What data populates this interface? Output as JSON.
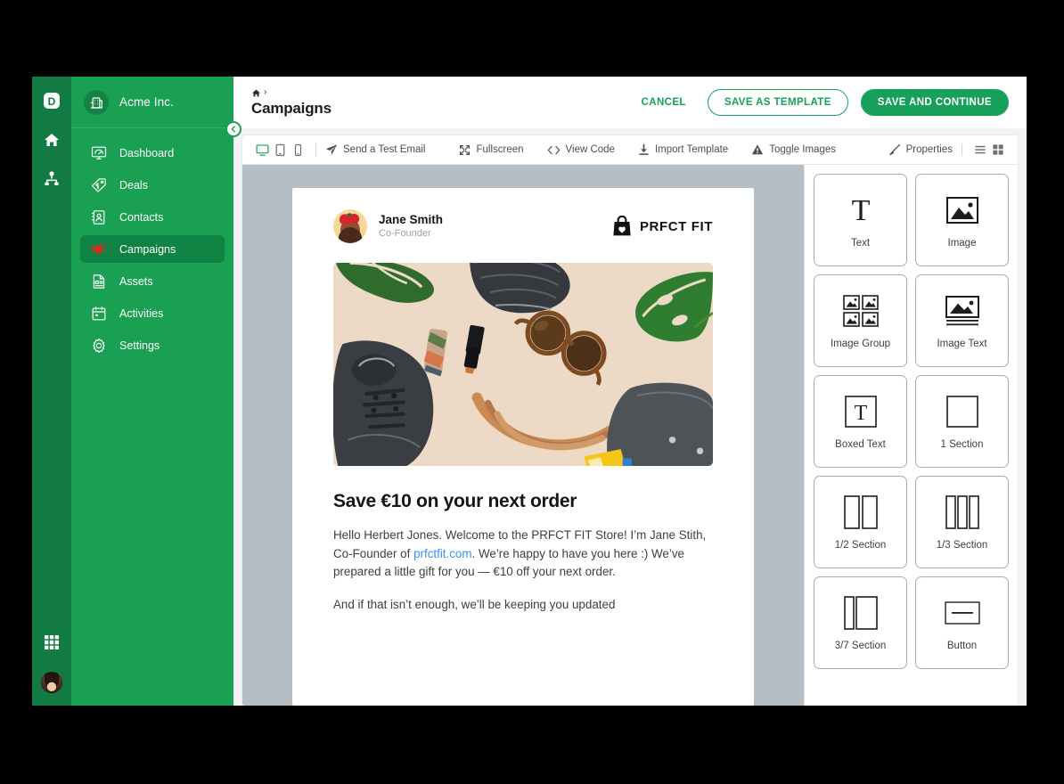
{
  "rail": {
    "items": [
      {
        "name": "app-logo",
        "icon": "d-logo-icon"
      },
      {
        "name": "home",
        "icon": "home-icon"
      },
      {
        "name": "org-tree",
        "icon": "hierarchy-icon"
      }
    ],
    "bottom": [
      {
        "name": "apps-grid",
        "icon": "grid-apps-icon"
      },
      {
        "name": "user-avatar",
        "icon": "avatar-icon"
      }
    ]
  },
  "sidebar": {
    "org_name": "Acme Inc.",
    "org_icon": "building-icon",
    "collapse_icon": "chevron-left-icon",
    "items": [
      {
        "label": "Dashboard",
        "icon": "dashboard-icon",
        "active": false
      },
      {
        "label": "Deals",
        "icon": "tag-icon",
        "active": false
      },
      {
        "label": "Contacts",
        "icon": "contacts-icon",
        "active": false
      },
      {
        "label": "Campaigns",
        "icon": "megaphone-icon",
        "active": true
      },
      {
        "label": "Assets",
        "icon": "assets-icon",
        "active": false
      },
      {
        "label": "Activities",
        "icon": "calendar-icon",
        "active": false
      },
      {
        "label": "Settings",
        "icon": "gear-icon",
        "active": false
      }
    ]
  },
  "header": {
    "breadcrumb_home_icon": "home-icon",
    "breadcrumb_separator": "›",
    "title": "Campaigns",
    "cancel_label": "CANCEL",
    "save_template_label": "SAVE AS TEMPLATE",
    "save_continue_label": "SAVE AND CONTINUE",
    "accent_color": "#17a05a"
  },
  "toolbar": {
    "devices": [
      {
        "name": "desktop-view",
        "icon": "desktop-icon",
        "active": true
      },
      {
        "name": "tablet-view",
        "icon": "tablet-icon",
        "active": false
      },
      {
        "name": "mobile-view",
        "icon": "mobile-icon",
        "active": false
      }
    ],
    "actions": [
      {
        "label": "Send a Test Email",
        "icon": "paper-plane-icon"
      },
      {
        "label": "Fullscreen",
        "icon": "fullscreen-icon"
      },
      {
        "label": "View Code",
        "icon": "code-brackets-icon"
      },
      {
        "label": "Import Template",
        "icon": "download-icon"
      },
      {
        "label": "Toggle Images",
        "icon": "image-alert-icon"
      },
      {
        "label": "Properties",
        "icon": "brush-icon"
      }
    ],
    "view_toggles": [
      {
        "name": "list-view-toggle",
        "icon": "list-icon",
        "active": false
      },
      {
        "name": "grid-view-toggle",
        "icon": "grid-icon",
        "active": true
      }
    ]
  },
  "email": {
    "sender_name": "Jane Smith",
    "sender_role": "Co-Founder",
    "sender_avatar_icon": "avatar-icon",
    "brand_name": "PRFCT FIT",
    "brand_icon": "shopping-bag-heart-icon",
    "hero_alt": "flat-lay of sneakers, sunglasses, lipstick and a leather bag on beige background",
    "headline": "Save €10 on your next order",
    "paragraph_1_before_link": "Hello Herbert Jones. Welcome to the PRFCT FIT Store! I’m Jane Stith, Co-Founder of ",
    "paragraph_1_link": "prfctfit.com",
    "paragraph_1_after_link": ". We’re happy to have you here :) We’ve prepared  a little gift for you — €10 off your next order.",
    "paragraph_2": "And if that isn’t enough, we’ll be keeping you updated",
    "link_color": "#3b8ef0"
  },
  "blocks_panel": {
    "blocks": [
      {
        "label": "Text",
        "icon": "text-t-icon"
      },
      {
        "label": "Image",
        "icon": "image-icon"
      },
      {
        "label": "Image Group",
        "icon": "image-group-icon"
      },
      {
        "label": "Image Text",
        "icon": "image-text-icon"
      },
      {
        "label": "Boxed Text",
        "icon": "boxed-text-icon"
      },
      {
        "label": "1 Section",
        "icon": "one-section-icon"
      },
      {
        "label": "1/2 Section",
        "icon": "half-section-icon"
      },
      {
        "label": "1/3 Section",
        "icon": "third-section-icon"
      },
      {
        "label": "3/7 Section",
        "icon": "three-seven-section-icon"
      },
      {
        "label": "Button",
        "icon": "button-icon"
      }
    ]
  }
}
